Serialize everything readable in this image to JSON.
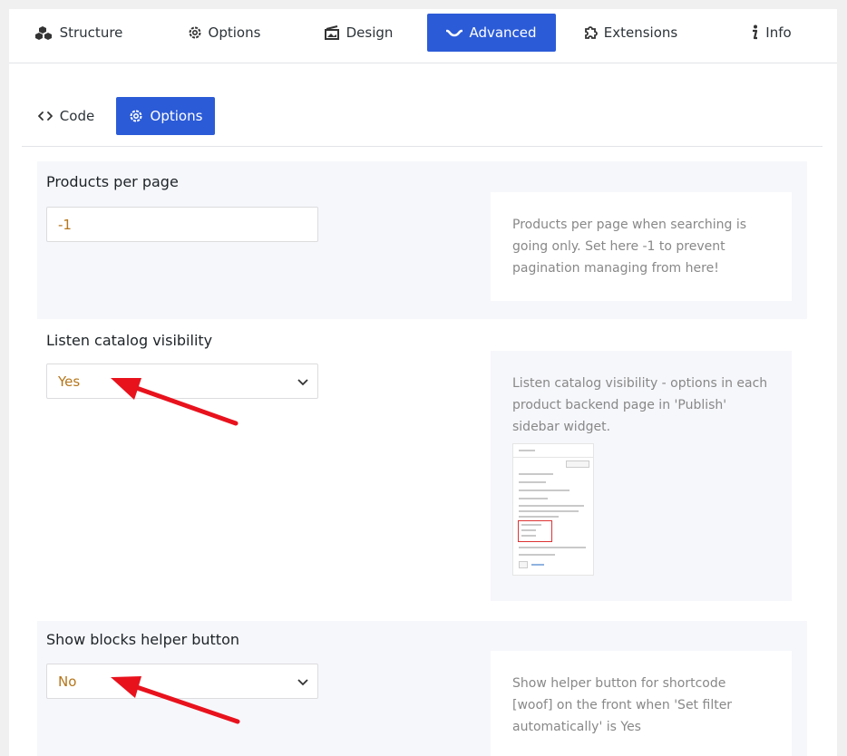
{
  "top_tabs": [
    {
      "label": "Structure",
      "icon": "cubes-icon"
    },
    {
      "label": "Options",
      "icon": "gear-icon"
    },
    {
      "label": "Design",
      "icon": "design-icon"
    },
    {
      "label": "Advanced",
      "icon": "advanced-icon",
      "active": true
    },
    {
      "label": "Extensions",
      "icon": "puzzle-icon"
    },
    {
      "label": "Info",
      "icon": "info-icon"
    }
  ],
  "sub_tabs": [
    {
      "label": "Code",
      "icon": "code-icon"
    },
    {
      "label": "Options",
      "icon": "gear-icon",
      "active": true
    }
  ],
  "settings": {
    "products_per_page": {
      "label": "Products per page",
      "value": "-1",
      "help": "Products per page when searching is going only. Set here -1 to prevent pagination managing from here!"
    },
    "listen_catalog_visibility": {
      "label": "Listen catalog visibility",
      "value": "Yes",
      "help": "Listen catalog visibility - options in each product backend page in 'Publish' sidebar widget."
    },
    "show_blocks_helper_button": {
      "label": "Show blocks helper button",
      "value": "No",
      "help": "Show helper button for shortcode [woof] on the front when 'Set filter automatically' is Yes"
    }
  },
  "colors": {
    "accent": "#2b5bd7",
    "value_text": "#b5761b",
    "annotation_arrow": "#e8121d"
  }
}
